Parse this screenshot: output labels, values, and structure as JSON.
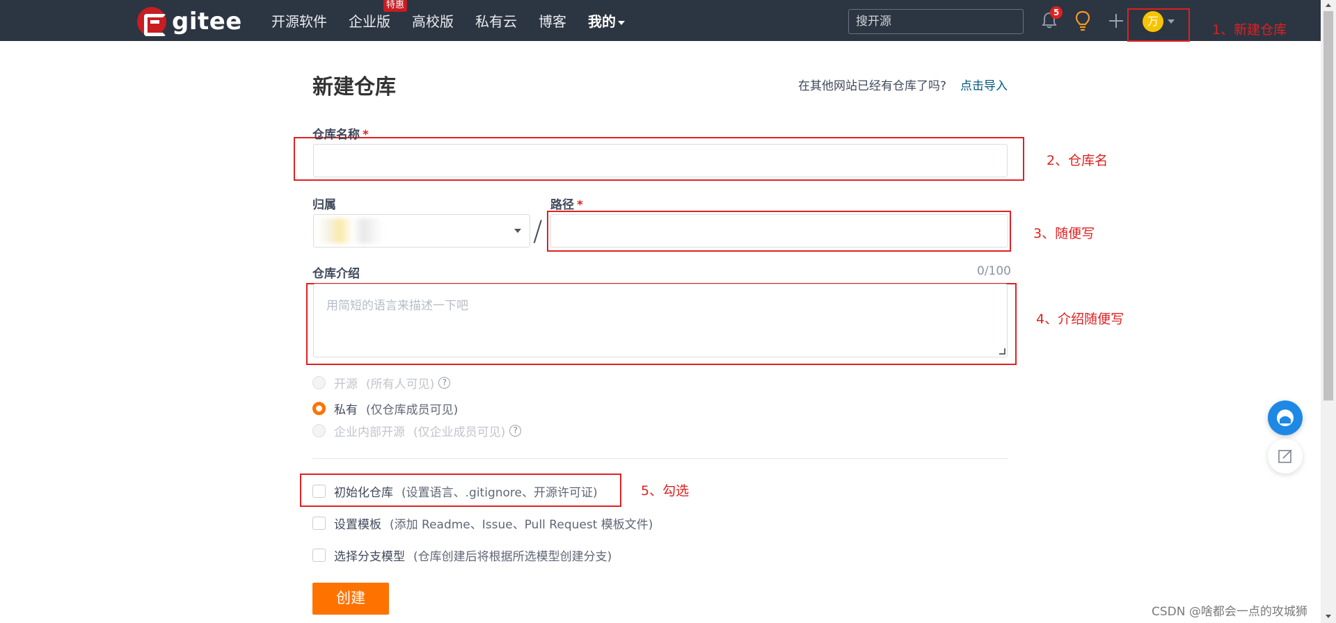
{
  "nav": {
    "logo_text": "gitee",
    "items": [
      {
        "label": "开源软件"
      },
      {
        "label": "企业版",
        "badge": "特惠"
      },
      {
        "label": "高校版"
      },
      {
        "label": "私有云"
      },
      {
        "label": "博客"
      },
      {
        "label": "我的"
      }
    ],
    "search_placeholder": "搜开源",
    "notification_count": "5",
    "avatar_letter": "万"
  },
  "annotations": [
    {
      "text": "1、新建仓库"
    },
    {
      "text": "2、仓库名"
    },
    {
      "text": "3、随便写"
    },
    {
      "text": "4、介绍随便写"
    },
    {
      "text": "5、勾选"
    }
  ],
  "form": {
    "title": "新建仓库",
    "import_question": "在其他网站已经有仓库了吗?",
    "import_link": "点击导入",
    "name_label": "仓库名称",
    "name_value": "",
    "required_mark": "*",
    "owner_label": "归属",
    "path_label": "路径",
    "path_value": "",
    "separator": "/",
    "intro_label": "仓库介绍",
    "intro_counter": "0/100",
    "intro_placeholder": "用简短的语言来描述一下吧",
    "visibility": [
      {
        "label": "开源",
        "hint": "(所有人可见)",
        "selected": false,
        "help": true
      },
      {
        "label": "私有",
        "hint": "(仅仓库成员可见)",
        "selected": true,
        "help": false
      },
      {
        "label": "企业内部开源",
        "hint": "(仅企业成员可见)",
        "selected": false,
        "help": true
      }
    ],
    "options": [
      {
        "label": "初始化仓库",
        "hint": "(设置语言、.gitignore、开源许可证)",
        "checked": false
      },
      {
        "label": "设置模板",
        "hint": "(添加 Readme、Issue、Pull Request 模板文件)",
        "checked": false
      },
      {
        "label": "选择分支模型",
        "hint": "(仓库创建后将根据所选模型创建分支)",
        "checked": false
      }
    ],
    "submit_label": "创建"
  },
  "watermark": "CSDN @啥都会一点的攻城狮",
  "colors": {
    "topbar": "#2c3542",
    "accent": "#fe7300",
    "annotation": "#e02020",
    "link": "#005980"
  }
}
